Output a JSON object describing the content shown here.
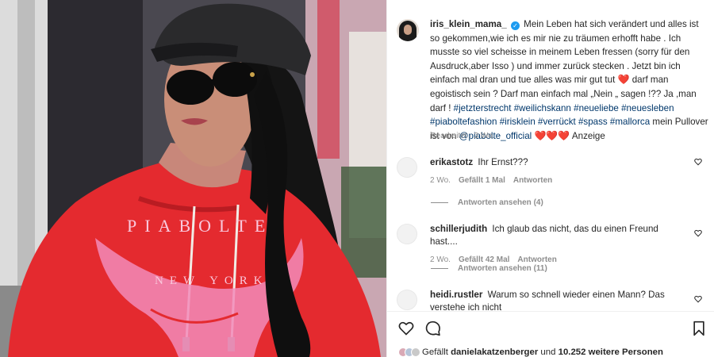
{
  "post": {
    "username": "iris_klein_mama_",
    "verified_icon": "verified-check-icon",
    "caption_parts": {
      "p1": "Mein Leben hat sich verändert und alles ist so gekommen,wie ich es mir nie zu träumen erhofft habe . Ich musste so viel scheisse in meinem Leben fressen (sorry für den Ausdruck,aber Isso ) und immer zurück stecken . Jetzt bin ich einfach mal dran und tue alles was mir gut tut",
      "p2": "darf man egoistisch sein ? Darf man einfach mal „Nein „ sagen !?? Ja ,man darf !",
      "hashtags": [
        "#jetzterstrecht",
        "#weilichskann",
        "#neueliebe",
        "#neuesleben",
        "#piaboltefashion",
        "#irisklein",
        "#verrückt",
        "#spass",
        "#mallorca"
      ],
      "p3": "mein Pullover ist von",
      "mention": "@piabolte_official",
      "p4": "Anzeige"
    },
    "heart_emoji": "❤️",
    "meta": "Bearbeitet · 2 Wo."
  },
  "comments": [
    {
      "username": "erikastotz",
      "text": "Ihr Ernst???",
      "age": "2 Wo.",
      "likes": "Gefällt 1 Mal",
      "reply_label": "Antworten",
      "view_replies": "Antworten ansehen (4)"
    },
    {
      "username": "schillerjudith",
      "text": "Ich glaub das nicht, das du einen Freund hast....",
      "age": "2 Wo.",
      "likes": "Gefällt 42 Mal",
      "reply_label": "Antworten",
      "view_replies": "Antworten ansehen (11)"
    },
    {
      "username": "heidi.rustler",
      "text": "Warum so schnell wieder einen Mann? Das verstehe ich nicht",
      "age": "",
      "likes": "",
      "reply_label": "",
      "view_replies": ""
    }
  ],
  "actions": {
    "like_icon": "heart-outline-icon",
    "comment_icon": "comment-bubble-icon",
    "save_icon": "bookmark-icon"
  },
  "likes_summary": {
    "prefix": "Gefällt",
    "user": "danielakatzenberger",
    "connector": "und",
    "others": "10.252 weitere Personen"
  },
  "media": {
    "hoodie_brand_line1": "PIABOLTE",
    "hoodie_brand_line2": "NEW YORK"
  },
  "colors": {
    "hoodie_red": "#e42a2f",
    "link_blue": "#00376b",
    "heart_red": "#ed1c24",
    "verified_blue": "#1d9bf0"
  }
}
